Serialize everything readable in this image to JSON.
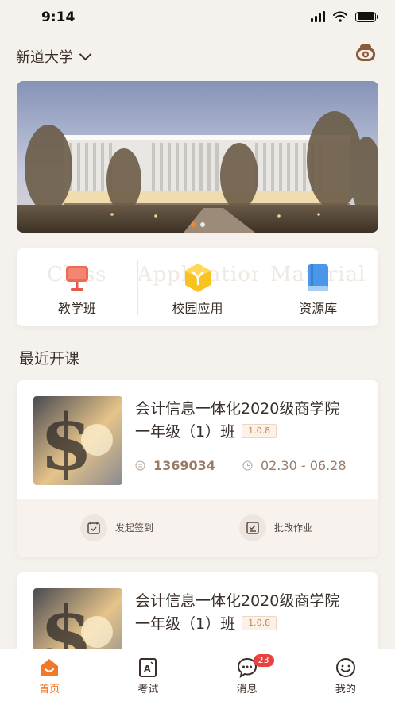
{
  "status": {
    "time": "9:14"
  },
  "header": {
    "school": "新道大学",
    "icons": {
      "switch": "chevron-down-icon",
      "service": "robot-icon"
    }
  },
  "banner": {
    "pages": 2,
    "active_page": 1
  },
  "quick_entries": [
    {
      "label": "教学班",
      "bg_text": "Class",
      "icon": "presentation-board-icon",
      "color": "#e55a4a"
    },
    {
      "label": "校园应用",
      "bg_text": "Application",
      "icon": "hexagon-app-icon",
      "color": "#f5b21c"
    },
    {
      "label": "资源库",
      "bg_text": "Material",
      "icon": "book-icon",
      "color": "#3f8fe6"
    }
  ],
  "section": {
    "title": "最近开课"
  },
  "courses": [
    {
      "title_line1": "会计信息一体化2020级商学院",
      "title_line2": "一年级（1）班",
      "version": "1.0.8",
      "code": "1369034",
      "period": "02.30 - 06.28",
      "actions": [
        "发起签到",
        "批改作业"
      ]
    },
    {
      "title_line1": "会计信息一体化2020级商学院",
      "title_line2": "一年级（1）班",
      "version": "1.0.8"
    }
  ],
  "tabbar": [
    {
      "label": "首页",
      "icon": "home-icon",
      "active": true
    },
    {
      "label": "考试",
      "icon": "exam-icon"
    },
    {
      "label": "消息",
      "icon": "message-icon",
      "badge": "23"
    },
    {
      "label": "我的",
      "icon": "smile-profile-icon"
    }
  ],
  "colors": {
    "accent": "#f07a2a",
    "background": "#f5f2ee",
    "badge": "#e94040"
  }
}
